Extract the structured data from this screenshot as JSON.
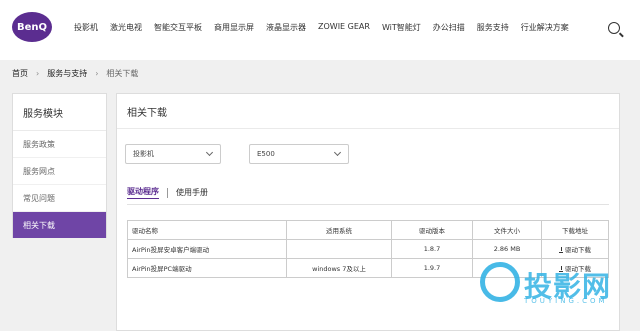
{
  "brand": {
    "logo_text": "BenQ"
  },
  "nav": [
    "投影机",
    "激光电视",
    "智能交互平板",
    "商用显示屏",
    "液晶显示器",
    "ZOWIE GEAR",
    "WiT智能灯",
    "办公扫描",
    "服务支持",
    "行业解决方案"
  ],
  "breadcrumb": {
    "home": "首页",
    "service": "服务与支持",
    "current": "相关下载"
  },
  "sidebar": {
    "title": "服务模块",
    "items": [
      "服务政策",
      "服务网点",
      "常见问题",
      "相关下载"
    ],
    "active_index": 3
  },
  "main": {
    "title": "相关下载",
    "filter_category": "投影机",
    "filter_model": "E500",
    "tabs": [
      "驱动程序",
      "使用手册"
    ],
    "active_tab": 0
  },
  "table": {
    "headers": [
      "驱动名称",
      "适用系统",
      "驱动版本",
      "文件大小",
      "下载地址"
    ],
    "rows": [
      {
        "name": "AirPin投屏安卓客户端驱动",
        "system": "",
        "version": "1.8.7",
        "size": "2.86 MB",
        "action": "驱动下载"
      },
      {
        "name": "AirPin投屏PC端驱动",
        "system": "windows 7及以上",
        "version": "1.9.7",
        "size": "",
        "action": "驱动下载"
      }
    ]
  },
  "watermark": {
    "text": "投影网",
    "sub": "TOUYING.COM"
  },
  "colors": {
    "accent": "#6f45a6",
    "brand": "#5b2d90",
    "watermark": "#34b3e4"
  }
}
